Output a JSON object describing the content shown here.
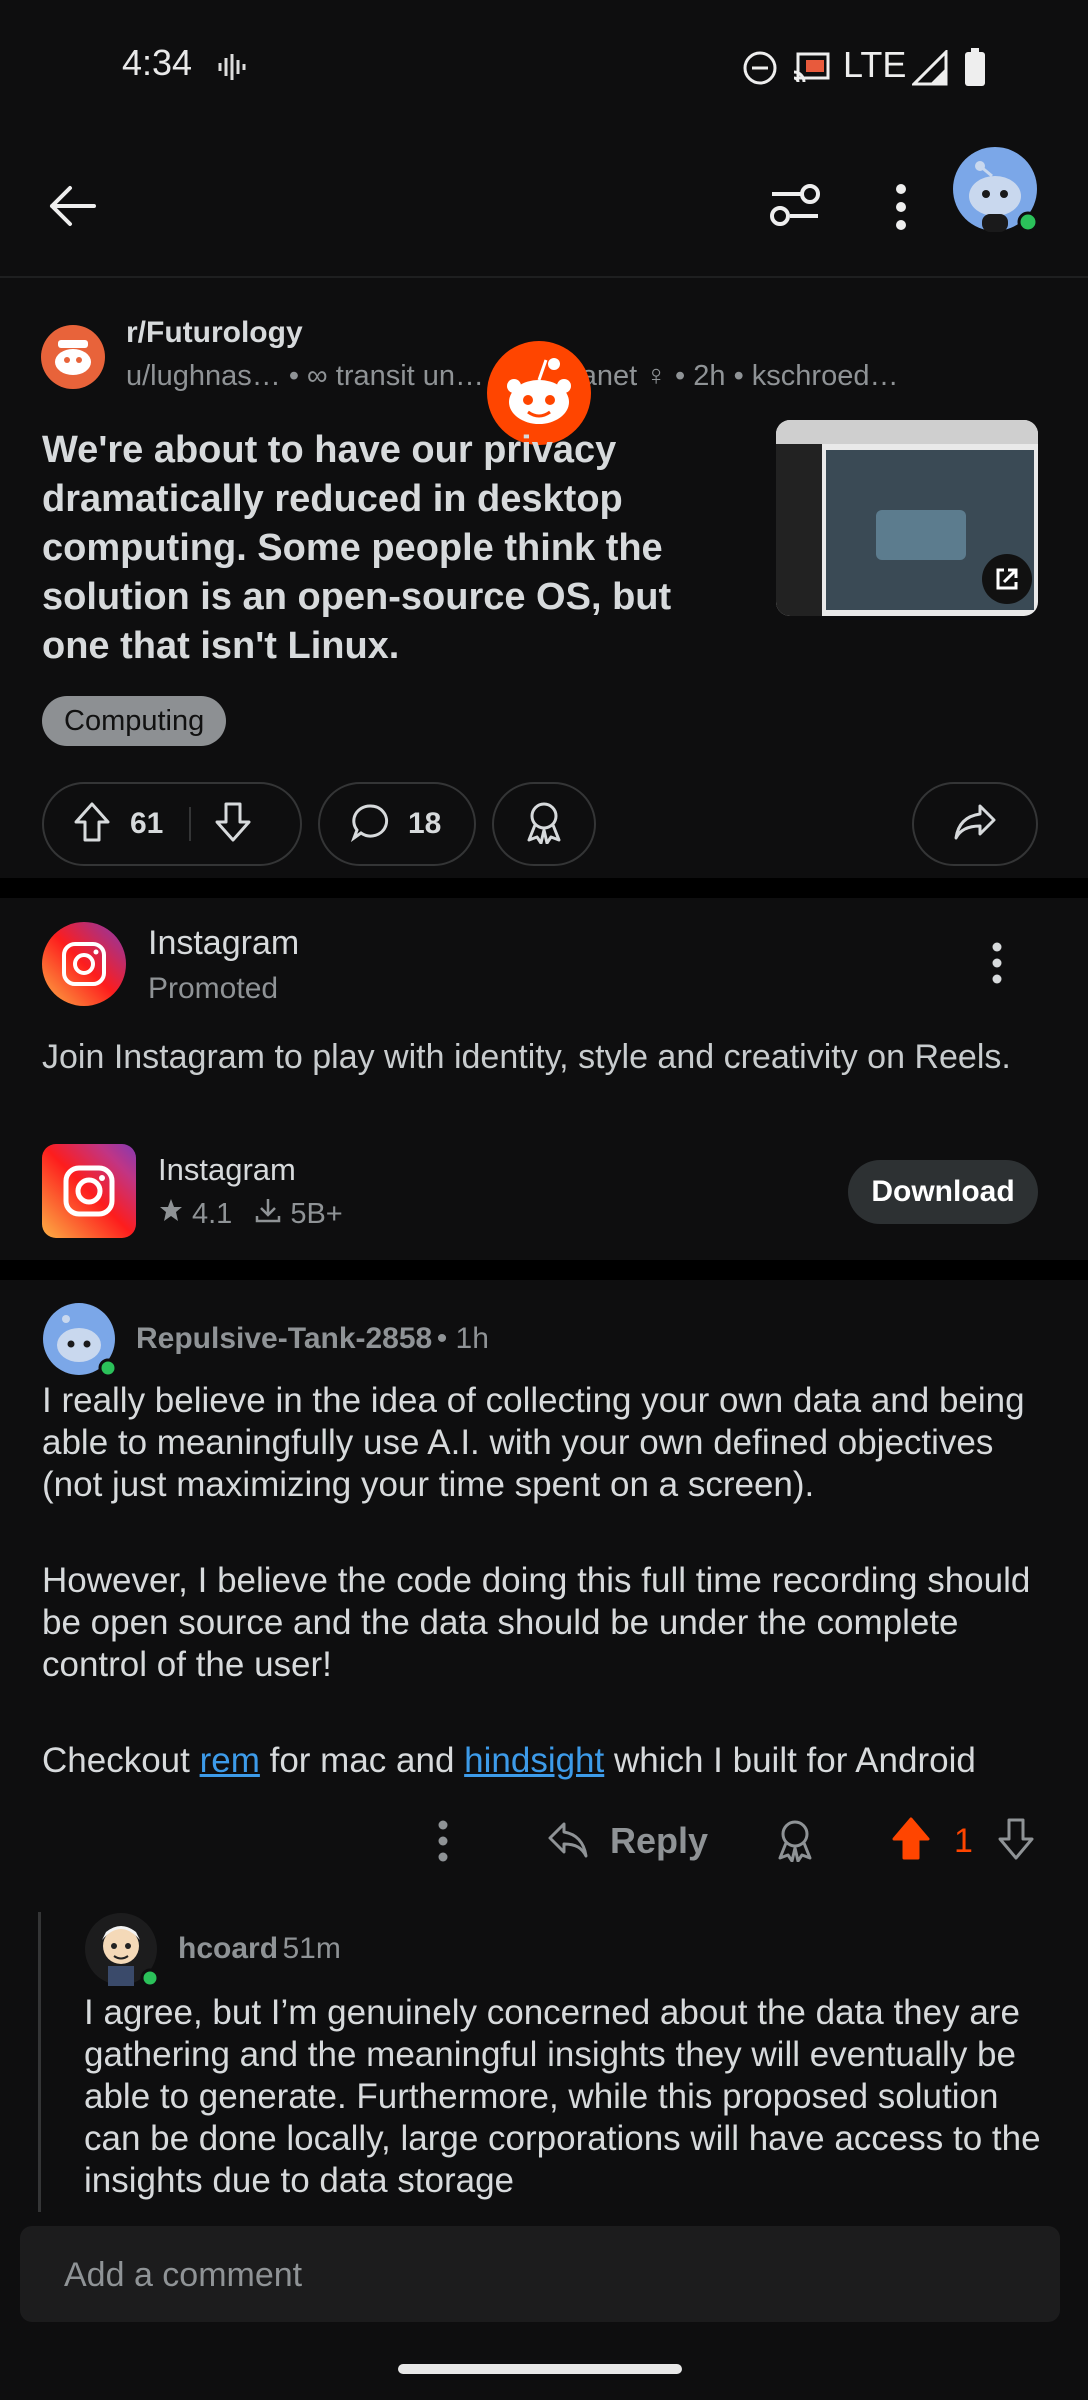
{
  "status": {
    "time": "4:34",
    "network": "LTE"
  },
  "post": {
    "subreddit": "r/Futurology",
    "meta": "u/lughnas… • ∞ transit un… x permanet ♀ • 2h • kschroed…",
    "title": "We're about to have our privacy dramatically reduced in desktop computing. Some people think the solution is an open-source OS, but one that isn't Linux.",
    "flair": "Computing",
    "upvotes": "61",
    "comments": "18"
  },
  "ad": {
    "advertiser": "Instagram",
    "promoted_label": "Promoted",
    "text": "Join Instagram to play with identity, style and creativity on Reels.",
    "app_name": "Instagram",
    "rating": "4.1",
    "downloads": "5B+",
    "download_label": "Download"
  },
  "comments": [
    {
      "author": "Repulsive-Tank-2858",
      "time": "• 1h",
      "p1": "I really believe in the idea of collecting your own data and being able to meaningfully use A.I. with your own defined objectives (not just maximizing your time spent on a screen).",
      "p2": "However, I believe the code doing this full time recording should be open source and the data should be under the complete control of the user!",
      "p3_pre": "Checkout ",
      "p3_link1": "rem",
      "p3_mid": " for mac and ",
      "p3_link2": "hindsight",
      "p3_post": " which I built for Android",
      "reply_label": "Reply",
      "votes": "1"
    },
    {
      "author": "hcoard",
      "time": "51m",
      "body": "I agree, but I’m genuinely concerned about the data they are gathering and the meaningful insights they will eventually be able to generate. Furthermore, while this proposed solution can be done locally, large corporations will have access to the insights due to data storage"
    }
  ],
  "composer": {
    "placeholder": "Add a comment"
  },
  "colors": {
    "accent": "#ff4500",
    "link": "#3d9be9",
    "online": "#2bc15a",
    "background": "#0e0e0f"
  }
}
